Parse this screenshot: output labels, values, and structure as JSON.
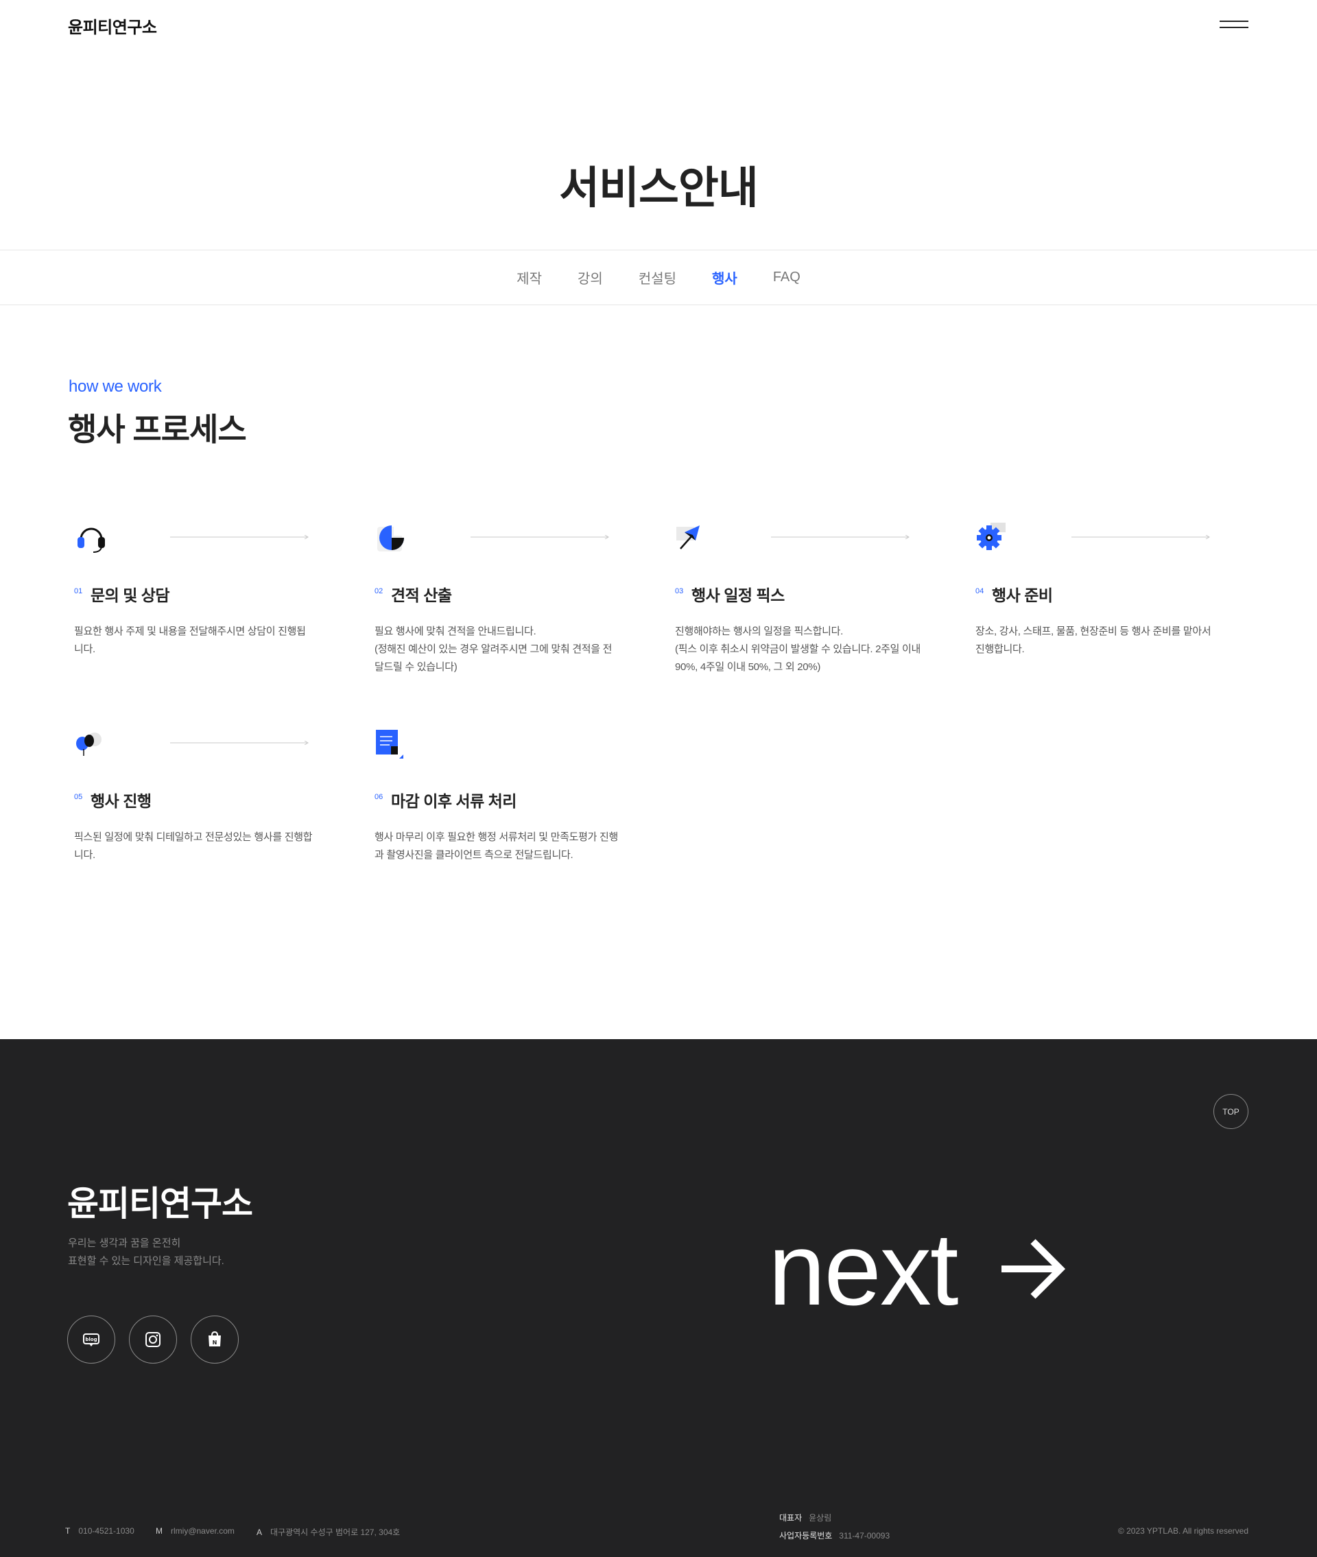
{
  "header": {
    "logo": "윤피티연구소",
    "menu_icon": "hamburger-menu-icon"
  },
  "hero": {
    "title": "서비스안내"
  },
  "tabs": [
    {
      "label": "제작",
      "active": false
    },
    {
      "label": "강의",
      "active": false
    },
    {
      "label": "컨설팅",
      "active": false
    },
    {
      "label": "행사",
      "active": true
    },
    {
      "label": "FAQ",
      "active": false
    }
  ],
  "process": {
    "kicker": "how we work",
    "title": "행사 프로세스",
    "steps": [
      {
        "num": "01",
        "name": "문의 및 상담",
        "icon": "headset-icon",
        "desc": [
          "필요한 행사 주제 및 내용을 전달해주시면 상담이 진행됩",
          "니다."
        ]
      },
      {
        "num": "02",
        "name": "견적 산출",
        "icon": "pie-chart-icon",
        "desc": [
          "필요 행사에 맞춰 견적을 안내드립니다.",
          "(정해진 예산이 있는 경우 알려주시면 그에 맞춰 견적을 전",
          "달드릴 수 있습니다)"
        ]
      },
      {
        "num": "03",
        "name": "행사 일정 픽스",
        "icon": "pin-icon",
        "desc": [
          "진행해야하는 행사의 일정을 픽스합니다.",
          "(픽스 이후 취소시 위약금이 발생할 수 있습니다. 2주일 이내",
          "90%, 4주일 이내 50%, 그 외 20%)"
        ]
      },
      {
        "num": "04",
        "name": "행사 준비",
        "icon": "gear-icon",
        "desc": [
          "장소, 강사, 스태프, 물품, 현장준비 등 행사 준비를 맡아서",
          "진행합니다."
        ]
      },
      {
        "num": "05",
        "name": "행사 진행",
        "icon": "balloon-icon",
        "desc": [
          "픽스된 일정에 맞춰 디테일하고 전문성있는 행사를 진행합",
          "니다."
        ]
      },
      {
        "num": "06",
        "name": "마감 이후 서류 처리",
        "icon": "document-icon",
        "desc": [
          "행사 마무리 이후 필요한 행정 서류처리 및 만족도평가 진행",
          "과 촬영사진을 클라이언트 측으로 전달드립니다."
        ]
      }
    ]
  },
  "footer": {
    "top_label": "TOP",
    "logo": "윤피티연구소",
    "tagline": [
      "우리는 생각과 꿈을 온전히",
      "표현할 수 있는 디자인을 제공합니다."
    ],
    "socials": [
      "blog-icon",
      "instagram-icon",
      "naver-store-icon"
    ],
    "next_label": "next",
    "next_icon": "arrow-right-icon",
    "contact": {
      "t_label": "T",
      "t_value": "010-4521-1030",
      "m_label": "M",
      "m_value": "rlmiy@naver.com",
      "a_label": "A",
      "a_value": "대구광역시 수성구 범어로 127, 304호"
    },
    "biz": {
      "ceo_label": "대표자",
      "ceo_value": "윤상림",
      "reg_label": "사업자등록번호",
      "reg_value": "311-47-00093"
    },
    "copyright": "© 2023 YPTLAB. All rights reserved"
  },
  "colors": {
    "accent": "#2962ff",
    "footer_bg": "#222223"
  }
}
